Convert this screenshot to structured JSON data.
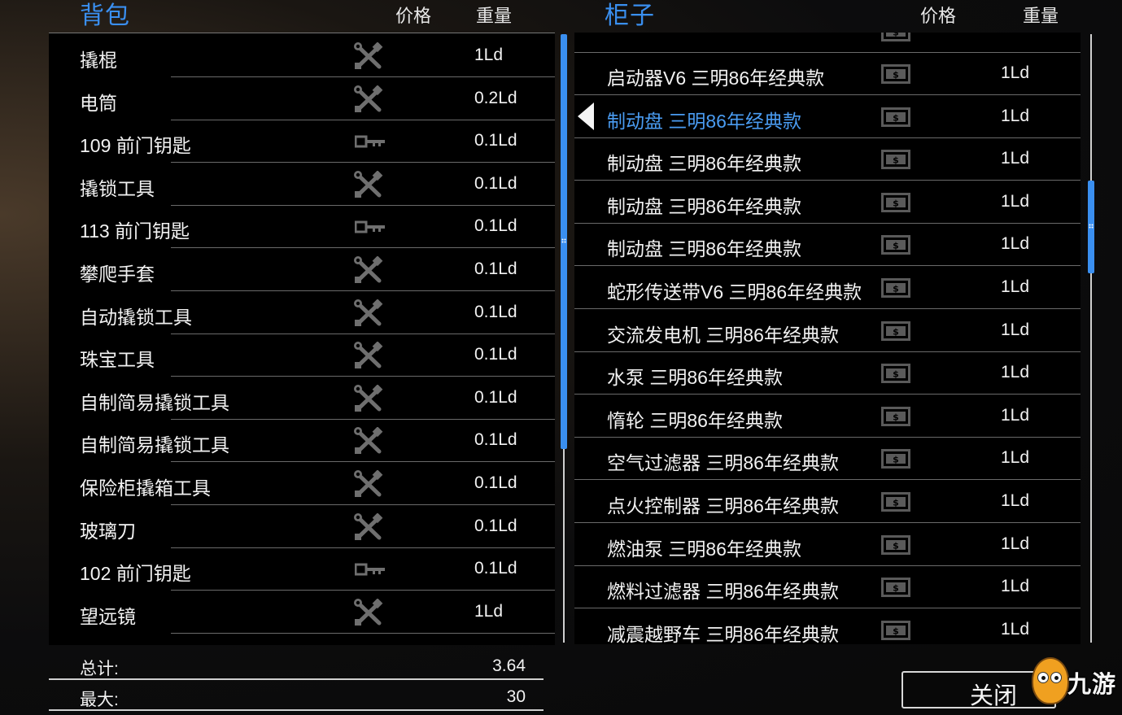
{
  "backpack": {
    "title": "背包",
    "col_price": "价格",
    "col_weight": "重量",
    "items": [
      {
        "name": "撬棍",
        "icon": "tools-icon",
        "weight": "1Ld"
      },
      {
        "name": "电筒",
        "icon": "tools-icon",
        "weight": "0.2Ld"
      },
      {
        "name": "109 前门钥匙",
        "icon": "key-icon",
        "weight": "0.1Ld"
      },
      {
        "name": "撬锁工具",
        "icon": "tools-icon",
        "weight": "0.1Ld"
      },
      {
        "name": "113 前门钥匙",
        "icon": "key-icon",
        "weight": "0.1Ld"
      },
      {
        "name": "攀爬手套",
        "icon": "tools-icon",
        "weight": "0.1Ld"
      },
      {
        "name": "自动撬锁工具",
        "icon": "tools-icon",
        "weight": "0.1Ld"
      },
      {
        "name": "珠宝工具",
        "icon": "tools-icon",
        "weight": "0.1Ld"
      },
      {
        "name": "自制简易撬锁工具",
        "icon": "tools-icon",
        "weight": "0.1Ld"
      },
      {
        "name": "自制简易撬锁工具",
        "icon": "tools-icon",
        "weight": "0.1Ld"
      },
      {
        "name": "保险柜撬箱工具",
        "icon": "tools-icon",
        "weight": "0.1Ld"
      },
      {
        "name": "玻璃刀",
        "icon": "tools-icon",
        "weight": "0.1Ld"
      },
      {
        "name": "102 前门钥匙",
        "icon": "key-icon",
        "weight": "0.1Ld"
      },
      {
        "name": "望远镜",
        "icon": "tools-icon",
        "weight": "1Ld"
      }
    ],
    "total_label": "总计:",
    "total_value": "3.64",
    "max_label": "最大:",
    "max_value": "30"
  },
  "cabinet": {
    "title": "柜子",
    "col_price": "价格",
    "col_weight": "重量",
    "items": [
      {
        "name": "启动器V6 三明86年经典款",
        "icon": "cash-icon",
        "weight": "1Ld"
      },
      {
        "name": "制动盘 三明86年经典款",
        "icon": "cash-icon",
        "weight": "1Ld",
        "selected": true
      },
      {
        "name": "制动盘 三明86年经典款",
        "icon": "cash-icon",
        "weight": "1Ld"
      },
      {
        "name": "制动盘 三明86年经典款",
        "icon": "cash-icon",
        "weight": "1Ld"
      },
      {
        "name": "制动盘 三明86年经典款",
        "icon": "cash-icon",
        "weight": "1Ld"
      },
      {
        "name": "蛇形传送带V6 三明86年经典款",
        "icon": "cash-icon",
        "weight": "1Ld"
      },
      {
        "name": "交流发电机 三明86年经典款",
        "icon": "cash-icon",
        "weight": "1Ld"
      },
      {
        "name": "水泵 三明86年经典款",
        "icon": "cash-icon",
        "weight": "1Ld"
      },
      {
        "name": "惰轮 三明86年经典款",
        "icon": "cash-icon",
        "weight": "1Ld"
      },
      {
        "name": "空气过滤器 三明86年经典款",
        "icon": "cash-icon",
        "weight": "1Ld"
      },
      {
        "name": "点火控制器 三明86年经典款",
        "icon": "cash-icon",
        "weight": "1Ld"
      },
      {
        "name": "燃油泵 三明86年经典款",
        "icon": "cash-icon",
        "weight": "1Ld"
      },
      {
        "name": "燃料过滤器 三明86年经典款",
        "icon": "cash-icon",
        "weight": "1Ld"
      },
      {
        "name": "减震越野车 三明86年经典款",
        "icon": "cash-icon",
        "weight": "1Ld"
      }
    ]
  },
  "close_button": "关闭",
  "watermark": "九游",
  "colors": {
    "accent": "#3a8ff0",
    "selected_text": "#4a9cf2",
    "panel_bg": "#000000"
  }
}
